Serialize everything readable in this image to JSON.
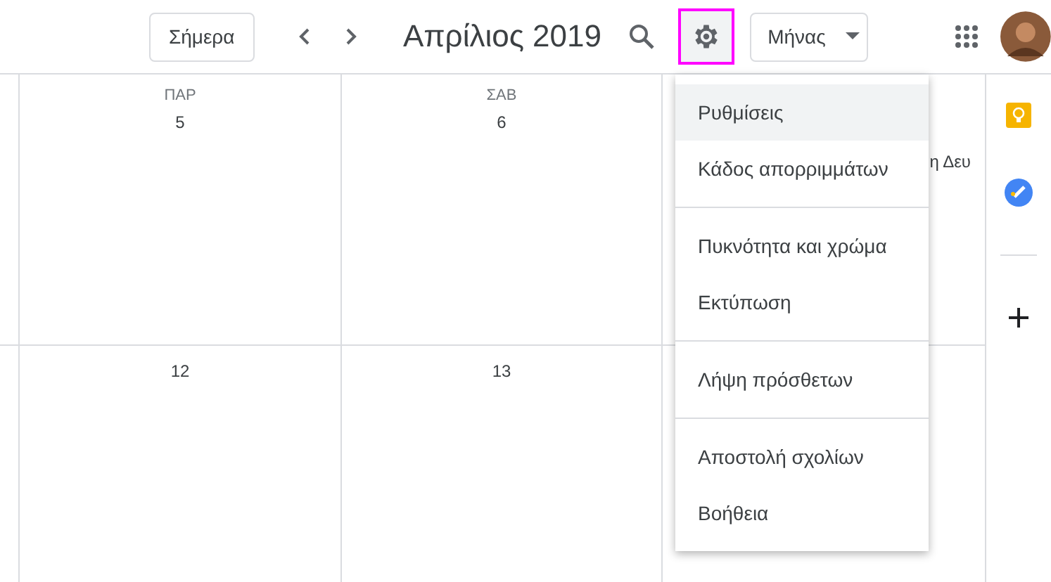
{
  "toolbar": {
    "today_button": "Σήμερα",
    "title": "Απρίλιος 2019",
    "settings_highlighted": true,
    "view_dropdown": "Μήνας"
  },
  "calendar": {
    "weeks": [
      {
        "cells": [
          {
            "weekday": "ΠΑΡ",
            "date": "5"
          },
          {
            "weekday": "ΣΑΒ",
            "date": "6"
          },
          {
            "event": "η Δευ"
          }
        ]
      },
      {
        "cells": [
          {
            "date": "12"
          },
          {
            "date": "13"
          },
          {}
        ]
      }
    ]
  },
  "menu": {
    "sections": [
      [
        {
          "label": "Ρυθμίσεις",
          "hovered": true
        },
        {
          "label": "Κάδος απορριμμάτων",
          "hovered": false
        }
      ],
      [
        {
          "label": "Πυκνότητα και χρώμα",
          "hovered": false
        },
        {
          "label": "Εκτύπωση",
          "hovered": false
        }
      ],
      [
        {
          "label": "Λήψη πρόσθετων",
          "hovered": false
        }
      ],
      [
        {
          "label": "Αποστολή σχολίων",
          "hovered": false
        },
        {
          "label": "Βοήθεια",
          "hovered": false
        }
      ]
    ]
  }
}
